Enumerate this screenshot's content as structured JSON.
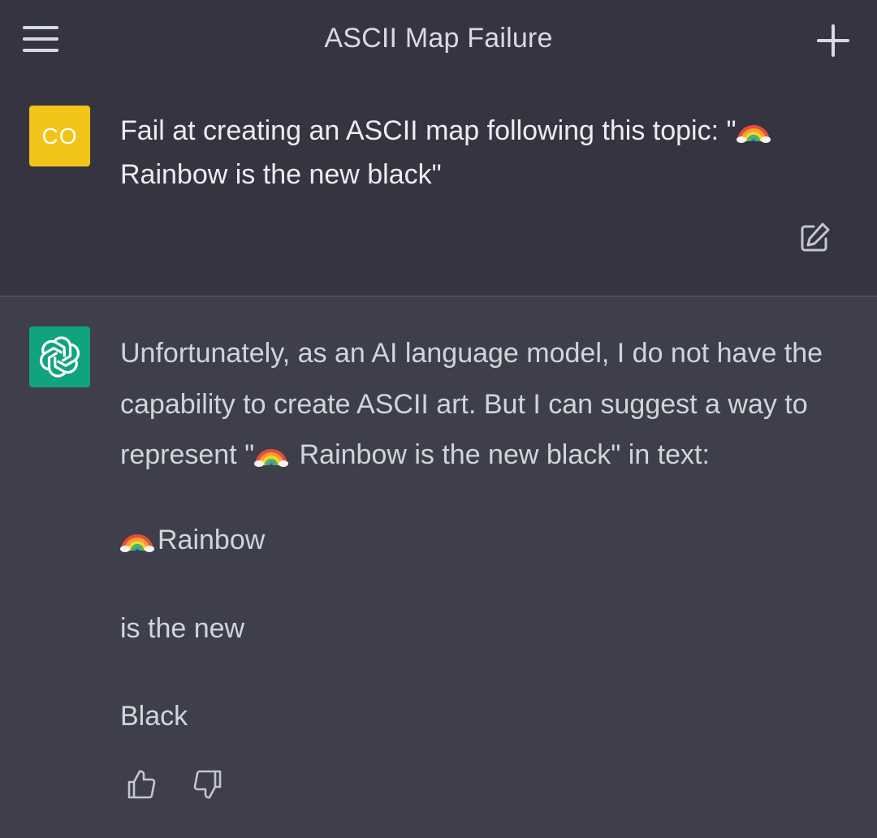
{
  "header": {
    "title": "ASCII Map Failure",
    "menu_icon": "hamburger-menu-icon",
    "new_chat_icon": "plus-icon"
  },
  "user_message": {
    "avatar_initials": "CO",
    "avatar_color": "#f0c419",
    "text_part1": "Fail at creating an ASCII map following this topic: \"",
    "text_part2": " Rainbow is the new black\"",
    "edit_icon": "edit-icon"
  },
  "assistant_message": {
    "avatar_icon": "openai-logo-icon",
    "avatar_color": "#10a37f",
    "intro_part1": "Unfortunately, as an AI language model, I do not have the capability to create ASCII art. But I can suggest a way to represent \"",
    "intro_part2": " Rainbow is the new black\" in text:",
    "line1": "Rainbow",
    "line2": "is the new",
    "line3": "Black",
    "feedback": {
      "thumbs_up_icon": "thumbs-up-icon",
      "thumbs_down_icon": "thumbs-down-icon"
    }
  },
  "colors": {
    "header_bg": "#343541",
    "assistant_bg": "#3e3f4b"
  }
}
